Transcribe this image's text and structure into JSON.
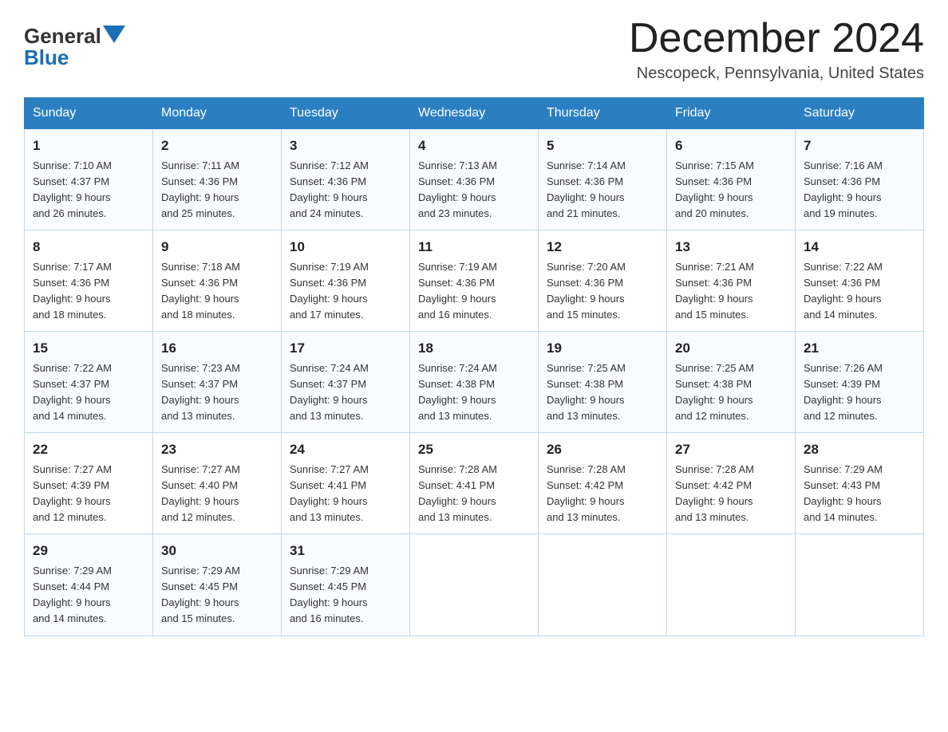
{
  "logo": {
    "general": "General",
    "blue": "Blue"
  },
  "header": {
    "month": "December 2024",
    "location": "Nescopeck, Pennsylvania, United States"
  },
  "days_of_week": [
    "Sunday",
    "Monday",
    "Tuesday",
    "Wednesday",
    "Thursday",
    "Friday",
    "Saturday"
  ],
  "weeks": [
    [
      {
        "day": "1",
        "sunrise": "7:10 AM",
        "sunset": "4:37 PM",
        "daylight": "9 hours and 26 minutes."
      },
      {
        "day": "2",
        "sunrise": "7:11 AM",
        "sunset": "4:36 PM",
        "daylight": "9 hours and 25 minutes."
      },
      {
        "day": "3",
        "sunrise": "7:12 AM",
        "sunset": "4:36 PM",
        "daylight": "9 hours and 24 minutes."
      },
      {
        "day": "4",
        "sunrise": "7:13 AM",
        "sunset": "4:36 PM",
        "daylight": "9 hours and 23 minutes."
      },
      {
        "day": "5",
        "sunrise": "7:14 AM",
        "sunset": "4:36 PM",
        "daylight": "9 hours and 21 minutes."
      },
      {
        "day": "6",
        "sunrise": "7:15 AM",
        "sunset": "4:36 PM",
        "daylight": "9 hours and 20 minutes."
      },
      {
        "day": "7",
        "sunrise": "7:16 AM",
        "sunset": "4:36 PM",
        "daylight": "9 hours and 19 minutes."
      }
    ],
    [
      {
        "day": "8",
        "sunrise": "7:17 AM",
        "sunset": "4:36 PM",
        "daylight": "9 hours and 18 minutes."
      },
      {
        "day": "9",
        "sunrise": "7:18 AM",
        "sunset": "4:36 PM",
        "daylight": "9 hours and 18 minutes."
      },
      {
        "day": "10",
        "sunrise": "7:19 AM",
        "sunset": "4:36 PM",
        "daylight": "9 hours and 17 minutes."
      },
      {
        "day": "11",
        "sunrise": "7:19 AM",
        "sunset": "4:36 PM",
        "daylight": "9 hours and 16 minutes."
      },
      {
        "day": "12",
        "sunrise": "7:20 AM",
        "sunset": "4:36 PM",
        "daylight": "9 hours and 15 minutes."
      },
      {
        "day": "13",
        "sunrise": "7:21 AM",
        "sunset": "4:36 PM",
        "daylight": "9 hours and 15 minutes."
      },
      {
        "day": "14",
        "sunrise": "7:22 AM",
        "sunset": "4:36 PM",
        "daylight": "9 hours and 14 minutes."
      }
    ],
    [
      {
        "day": "15",
        "sunrise": "7:22 AM",
        "sunset": "4:37 PM",
        "daylight": "9 hours and 14 minutes."
      },
      {
        "day": "16",
        "sunrise": "7:23 AM",
        "sunset": "4:37 PM",
        "daylight": "9 hours and 13 minutes."
      },
      {
        "day": "17",
        "sunrise": "7:24 AM",
        "sunset": "4:37 PM",
        "daylight": "9 hours and 13 minutes."
      },
      {
        "day": "18",
        "sunrise": "7:24 AM",
        "sunset": "4:38 PM",
        "daylight": "9 hours and 13 minutes."
      },
      {
        "day": "19",
        "sunrise": "7:25 AM",
        "sunset": "4:38 PM",
        "daylight": "9 hours and 13 minutes."
      },
      {
        "day": "20",
        "sunrise": "7:25 AM",
        "sunset": "4:38 PM",
        "daylight": "9 hours and 12 minutes."
      },
      {
        "day": "21",
        "sunrise": "7:26 AM",
        "sunset": "4:39 PM",
        "daylight": "9 hours and 12 minutes."
      }
    ],
    [
      {
        "day": "22",
        "sunrise": "7:27 AM",
        "sunset": "4:39 PM",
        "daylight": "9 hours and 12 minutes."
      },
      {
        "day": "23",
        "sunrise": "7:27 AM",
        "sunset": "4:40 PM",
        "daylight": "9 hours and 12 minutes."
      },
      {
        "day": "24",
        "sunrise": "7:27 AM",
        "sunset": "4:41 PM",
        "daylight": "9 hours and 13 minutes."
      },
      {
        "day": "25",
        "sunrise": "7:28 AM",
        "sunset": "4:41 PM",
        "daylight": "9 hours and 13 minutes."
      },
      {
        "day": "26",
        "sunrise": "7:28 AM",
        "sunset": "4:42 PM",
        "daylight": "9 hours and 13 minutes."
      },
      {
        "day": "27",
        "sunrise": "7:28 AM",
        "sunset": "4:42 PM",
        "daylight": "9 hours and 13 minutes."
      },
      {
        "day": "28",
        "sunrise": "7:29 AM",
        "sunset": "4:43 PM",
        "daylight": "9 hours and 14 minutes."
      }
    ],
    [
      {
        "day": "29",
        "sunrise": "7:29 AM",
        "sunset": "4:44 PM",
        "daylight": "9 hours and 14 minutes."
      },
      {
        "day": "30",
        "sunrise": "7:29 AM",
        "sunset": "4:45 PM",
        "daylight": "9 hours and 15 minutes."
      },
      {
        "day": "31",
        "sunrise": "7:29 AM",
        "sunset": "4:45 PM",
        "daylight": "9 hours and 16 minutes."
      },
      null,
      null,
      null,
      null
    ]
  ],
  "labels": {
    "sunrise": "Sunrise:",
    "sunset": "Sunset:",
    "daylight": "Daylight:"
  }
}
